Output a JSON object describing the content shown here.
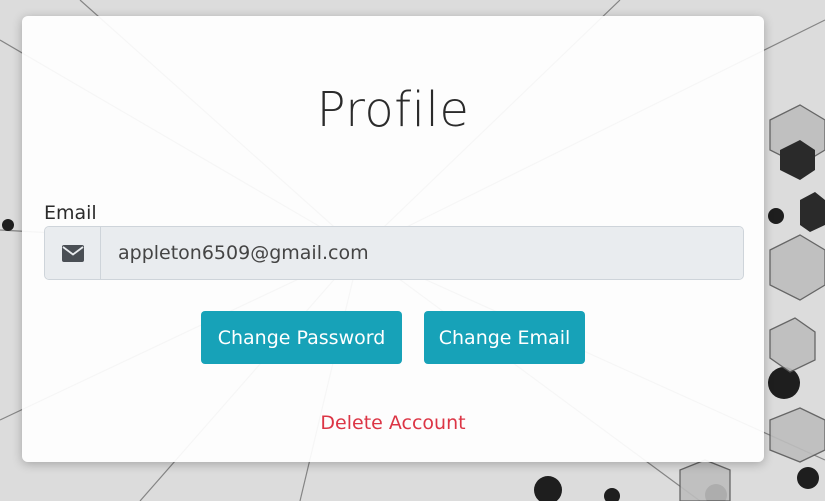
{
  "page": {
    "title": "Profile"
  },
  "email": {
    "label": "Email",
    "value": "appleton6509@gmail.com",
    "icon": "envelope-icon"
  },
  "actions": {
    "change_password": "Change Password",
    "change_email": "Change Email",
    "delete_account": "Delete Account"
  },
  "colors": {
    "primary_button": "#17a2b8",
    "danger_text": "#dc3545",
    "input_bg": "#e9ecef"
  }
}
